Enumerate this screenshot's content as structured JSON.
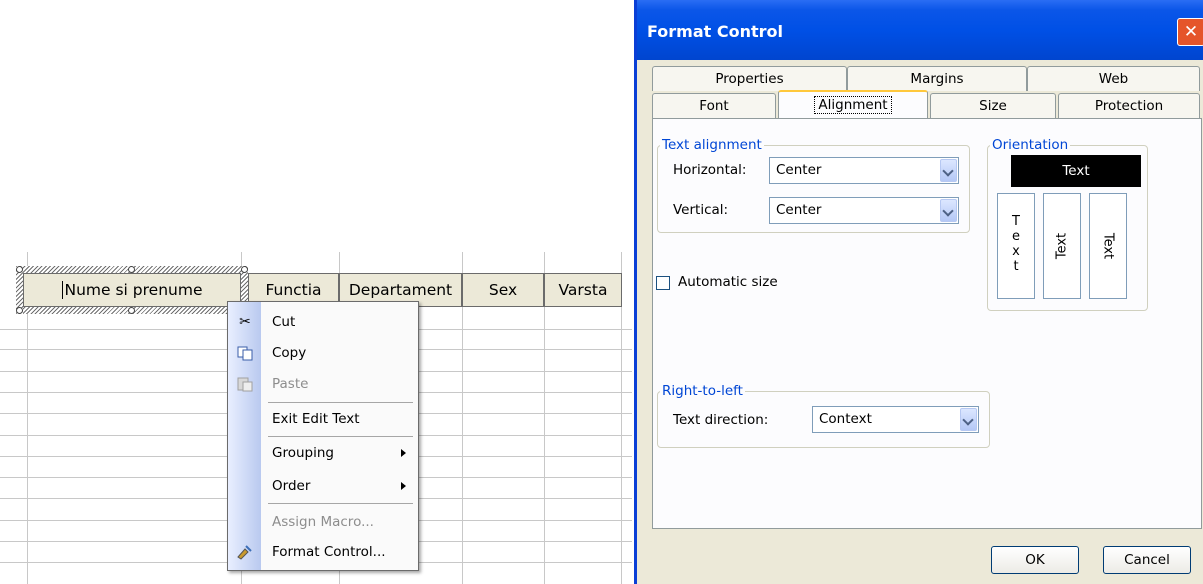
{
  "sheet": {
    "header_cells": [
      "Nume si prenume",
      "Functia",
      "Departament",
      "Sex",
      "Varsta"
    ]
  },
  "context_menu": {
    "items": [
      {
        "label": "Cut",
        "icon": "scissors-icon",
        "enabled": true
      },
      {
        "label": "Copy",
        "icon": "copy-icon",
        "enabled": true
      },
      {
        "label": "Paste",
        "icon": "paste-icon",
        "enabled": false
      },
      {
        "label": "Exit Edit Text",
        "enabled": true
      },
      {
        "label": "Grouping",
        "enabled": true,
        "submenu": true
      },
      {
        "label": "Order",
        "enabled": true,
        "submenu": true
      },
      {
        "label": "Assign Macro...",
        "enabled": false
      },
      {
        "label": "Format Control...",
        "icon": "format-control-icon",
        "enabled": true
      }
    ]
  },
  "dialog": {
    "title": "Format Control",
    "close_glyph": "✕",
    "tabs_row1": [
      "Properties",
      "Margins",
      "Web"
    ],
    "tabs_row2": [
      "Font",
      "Alignment",
      "Size",
      "Protection"
    ],
    "active_tab": "Alignment",
    "text_alignment": {
      "group_title": "Text alignment",
      "horizontal_label": "Horizontal:",
      "horizontal_value": "Center",
      "vertical_label": "Vertical:",
      "vertical_value": "Center"
    },
    "orientation": {
      "group_title": "Orientation",
      "horizontal_text": "Text",
      "stacked_text": "T e x t",
      "rotated_up_text": "Text",
      "rotated_down_text": "Text"
    },
    "automatic_size": {
      "label": "Automatic size",
      "checked": false
    },
    "right_to_left": {
      "group_title": "Right-to-left",
      "direction_label": "Text direction:",
      "direction_value": "Context"
    },
    "buttons": {
      "ok": "OK",
      "cancel": "Cancel"
    }
  },
  "colors": {
    "title_bar": "#0050e6",
    "group_title": "#0046d5",
    "tab_highlight": "#ffc83c"
  }
}
